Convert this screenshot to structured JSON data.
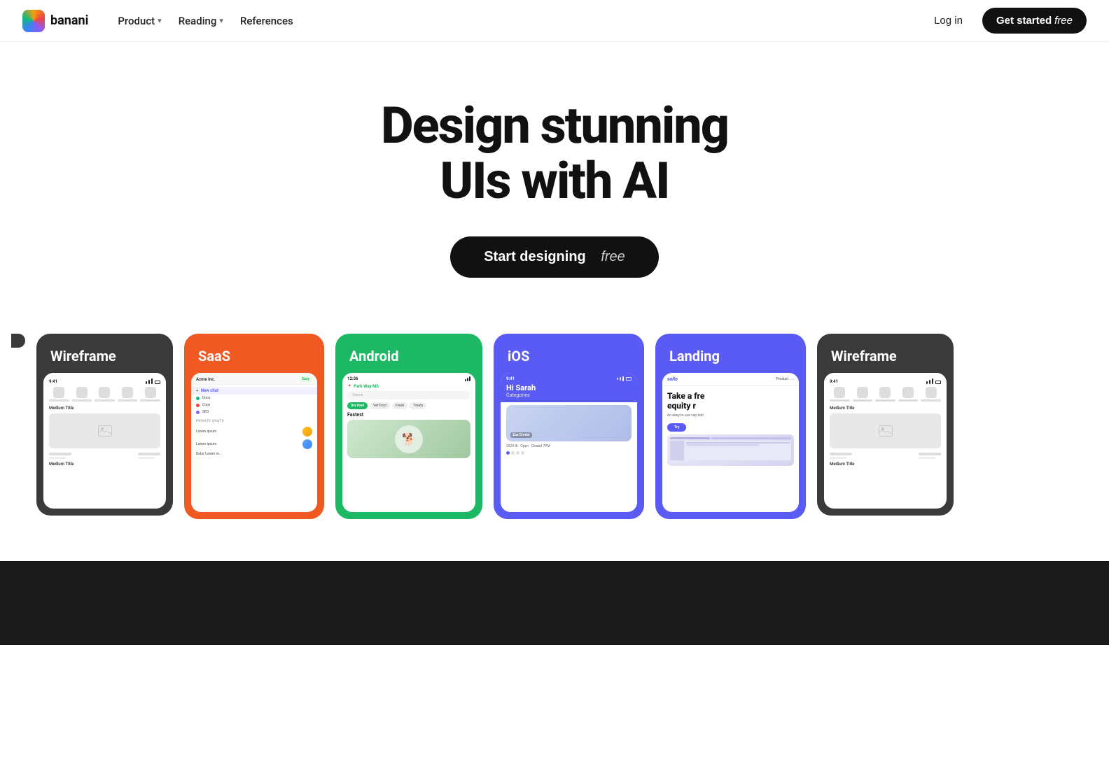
{
  "brand": {
    "name": "banani"
  },
  "nav": {
    "product_label": "Product",
    "reading_label": "Reading",
    "references_label": "References",
    "login_label": "Log in",
    "cta_label": "Get started",
    "cta_free": "free"
  },
  "hero": {
    "title_line1": "Design stunning",
    "title_line2": "UIs with AI",
    "cta_label": "Start designing",
    "cta_free": "free"
  },
  "cards": [
    {
      "id": "wireframe-left-partial",
      "label": "",
      "color": "#3a3a3a",
      "type": "partial-left"
    },
    {
      "id": "wireframe1",
      "label": "Wireframe",
      "color": "#3a3a3a",
      "type": "wireframe"
    },
    {
      "id": "saas",
      "label": "SaaS",
      "color": "#f05a22",
      "type": "saas"
    },
    {
      "id": "android",
      "label": "Android",
      "color": "#1db863",
      "type": "android"
    },
    {
      "id": "ios",
      "label": "iOS",
      "color": "#5a5af5",
      "type": "ios"
    },
    {
      "id": "landing",
      "label": "Landing",
      "color": "#5a5af5",
      "type": "landing"
    },
    {
      "id": "wireframe2",
      "label": "Wireframe",
      "color": "#3a3a3a",
      "type": "wireframe"
    },
    {
      "id": "partial-right",
      "label": "",
      "color": "#f05a22",
      "type": "partial-right"
    }
  ],
  "saas_mockup": {
    "header": "Acme Inc.",
    "badge": "Easy",
    "rows": [
      {
        "label": "New chat",
        "dot_color": "#3b82f6"
      },
      {
        "label": "Docs",
        "dot_color": "#10b981"
      },
      {
        "label": "Copy",
        "dot_color": "#ef4444"
      },
      {
        "label": "SEO",
        "dot_color": "#8b5cf6"
      }
    ],
    "section1": "Private chats",
    "rows2": [
      {
        "label": "Lorem ipsum"
      },
      {
        "label": "Lorem ipsum"
      },
      {
        "label": "Dolor Lorem m..."
      }
    ]
  },
  "android_mockup": {
    "location": "Park Way MS",
    "search_placeholder": "Search",
    "chips": [
      "Dry food",
      "Vet food",
      "Fresh",
      "Treats"
    ],
    "active_chip": "Dry food",
    "section_label": "Fastest"
  },
  "ios_mockup": {
    "time": "9:41",
    "greeting": "Hi Sarah",
    "categories": "Categories",
    "place": "Zoo Cordel",
    "caption": "2029 lb • Open • Closed 7PM"
  },
  "landing_mockup": {
    "brand": "salto",
    "nav_links": [
      "Product",
      "..."
    ],
    "hero_line1": "Take a fre",
    "hero_line2": "equity r",
    "sub": "An easy-to-use cap tabl"
  }
}
